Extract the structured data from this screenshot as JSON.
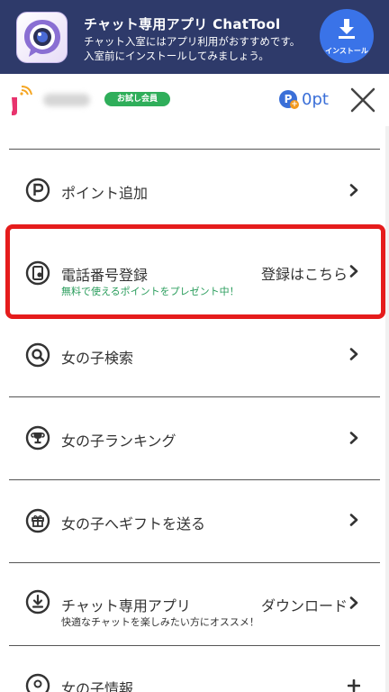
{
  "banner": {
    "title": "チャット専用アプリ ChatTool",
    "desc_line1": "チャット入室にはアプリ利用がおすすめです。",
    "desc_line2": "入室前にインストールしてみましょう。",
    "install_label": "インストール",
    "icon": "chat-app-icon"
  },
  "header": {
    "logo": "j-logo-icon",
    "badge": "お試し会員",
    "points_icon_letter": "P",
    "points_value": "0pt",
    "close_icon": "close-icon"
  },
  "menu": {
    "items": [
      {
        "label": "ポイント追加",
        "icon": "p-circle-icon",
        "right": "",
        "sub": ""
      },
      {
        "label": "電話番号登録",
        "icon": "phone-register-icon",
        "right": "登録はこちら",
        "sub": "無料で使えるポイントをプレゼント中！"
      },
      {
        "label": "女の子検索",
        "icon": "search-icon",
        "right": "",
        "sub": ""
      },
      {
        "label": "女の子ランキング",
        "icon": "trophy-icon",
        "right": "",
        "sub": ""
      },
      {
        "label": "女の子へギフトを送る",
        "icon": "gift-icon",
        "right": "",
        "sub": ""
      },
      {
        "label": "チャット専用アプリ",
        "icon": "download-icon",
        "right": "ダウンロード",
        "sub": "快適なチャットを楽しみたい方にオススメ！"
      },
      {
        "label": "女の子情報",
        "icon": "location-pin-icon",
        "right": "",
        "sub": ""
      }
    ]
  },
  "colors": {
    "banner_bg": "#2e3a6a",
    "install_blue": "#3a73e8",
    "badge_green": "#2fae5a",
    "points_blue": "#3a6fd8",
    "sub_green": "#2a9d5c",
    "highlight_red": "#e51c1c"
  }
}
